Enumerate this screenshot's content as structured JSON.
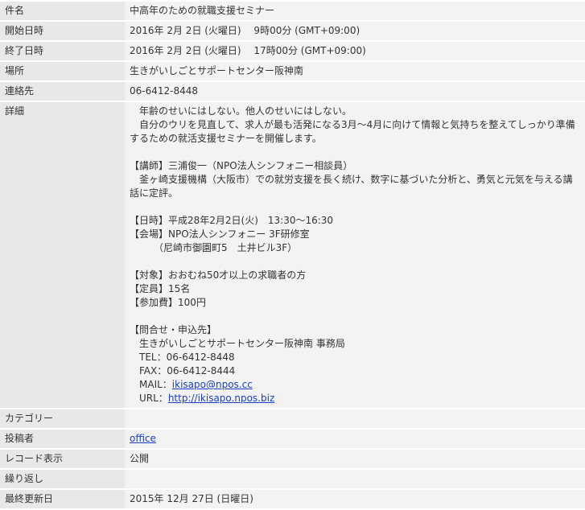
{
  "rows": {
    "title": {
      "label": "件名",
      "value": "中高年のための就職支援セミナー"
    },
    "start": {
      "label": "開始日時",
      "value": "2016年 2月 2日 (火曜日)　 9時00分 (GMT+09:00)"
    },
    "end": {
      "label": "終了日時",
      "value": "2016年 2月 2日 (火曜日)　 17時00分 (GMT+09:00)"
    },
    "place": {
      "label": "場所",
      "value": "生きがいしごとサポートセンター阪神南"
    },
    "contact": {
      "label": "連絡先",
      "value": "06-6412-8448"
    },
    "details": {
      "label": "詳細",
      "text_before": "　年齢のせいにはしない。他人のせいにはしない。\n　自分のウリを見直して、求人が最も活発になる3月～4月に向けて情報と気持ちを整えてしっかり準備するための就活支援セミナーを開催します。\n\n【講師】三浦俊一（NPO法人シンフォニー相談員）\n　釜ヶ崎支援機構（大阪市）での就労支援を長く続け、数字に基づいた分析と、勇気と元気を与える講話に定評。\n\n【日時】平成28年2月2日(火)　13:30～16:30\n【会場】NPO法人シンフォニー 3F研修室\n　　　（尼崎市御園町5　土井ビル3F）\n\n【対象】おおむね50才以上の求職者の方\n【定員】15名\n【参加費】100円\n\n【問合せ・申込先】\n　生きがいしごとサポートセンター阪神南 事務局\n　TEL：06-6412-8448\n　FAX：06-6412-8444\n　MAIL：",
      "mail": "ikisapo@npos.cc",
      "url_prefix": "\n　URL：",
      "url": "http://ikisapo.npos.biz"
    },
    "category": {
      "label": "カテゴリー",
      "value": ""
    },
    "poster": {
      "label": "投稿者",
      "value": "office"
    },
    "visibility": {
      "label": "レコード表示",
      "value": "公開"
    },
    "repeat": {
      "label": "繰り返し",
      "value": ""
    },
    "updated": {
      "label": "最終更新日",
      "value": "2015年 12月 27日 (日曜日)"
    }
  }
}
